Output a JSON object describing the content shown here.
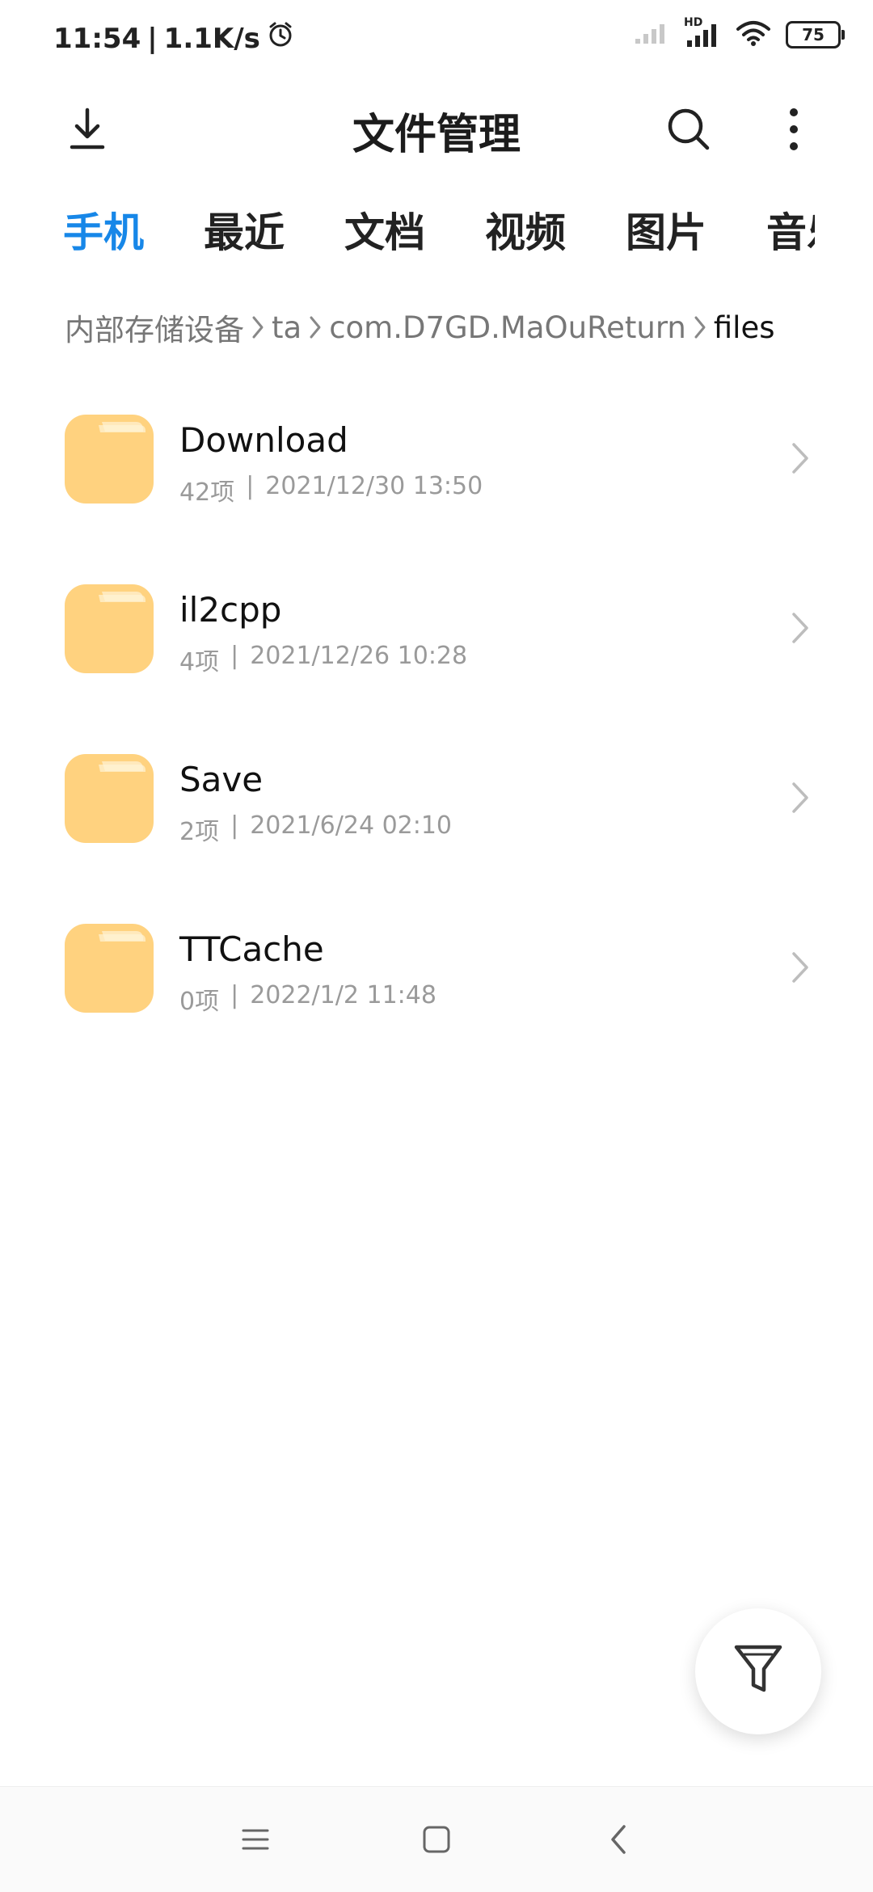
{
  "status_bar": {
    "time": "11:54",
    "speed": "1.1K/s",
    "network": "HD",
    "battery": "75",
    "icons": [
      "alarm-icon",
      "signal-weak-icon",
      "signal-hd-icon",
      "wifi-icon",
      "battery-icon"
    ]
  },
  "appbar": {
    "title": "文件管理",
    "icons": [
      "download-icon",
      "search-icon",
      "more-icon"
    ]
  },
  "tabs": [
    "手机",
    "最近",
    "文档",
    "视频",
    "图片",
    "音乐"
  ],
  "active_tab": "手机",
  "breadcrumb": {
    "items": [
      "内部存储设备",
      "ta",
      "com.D7GD.MaOuReturn",
      "files"
    ]
  },
  "files": [
    {
      "name": "Download",
      "count": "42项",
      "date": "2021/12/30 13:50"
    },
    {
      "name": "il2cpp",
      "count": "4项",
      "date": "2021/12/26 10:28"
    },
    {
      "name": "Save",
      "count": "2项",
      "date": "2021/6/24 02:10"
    },
    {
      "name": "TTCache",
      "count": "0项",
      "date": "2022/1/2 11:48"
    }
  ],
  "list_meta_separator": "|",
  "fab": {
    "icon": "filter-icon"
  },
  "navbar": {
    "icons": [
      "menu-icon",
      "home-icon",
      "back-icon"
    ]
  },
  "colors": {
    "accent": "#1787e8",
    "folder": "#FFD27F",
    "folder_tab": "#FFE3A8"
  }
}
